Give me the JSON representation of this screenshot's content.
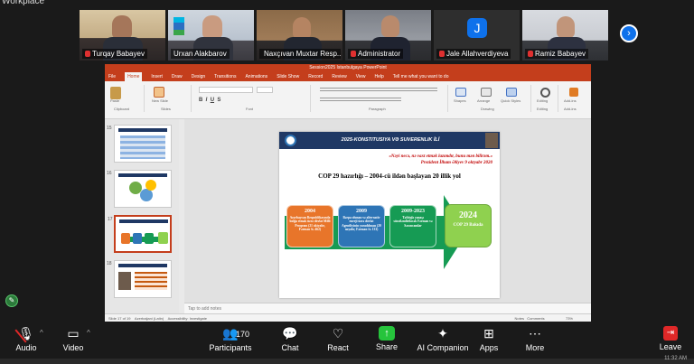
{
  "window": {
    "title": "Workplace"
  },
  "participants": [
    {
      "name": "Turqay Babayev",
      "muted": true
    },
    {
      "name": "Urxan Alakbarov",
      "muted": false,
      "active_speaker": true
    },
    {
      "name": "Naxçıvan Muxtar Resp...",
      "muted": true
    },
    {
      "name": "Administrator",
      "muted": true
    },
    {
      "name": "Jale Allahverdiyeva",
      "muted": true,
      "avatar_letter": "J"
    },
    {
      "name": "Ramiz Babayev",
      "muted": true
    }
  ],
  "gallery": {
    "next_icon": "chevron-right-icon"
  },
  "ppt": {
    "title_bar": "Session2025 Istanbulgaya PowerPoint",
    "tabs": [
      "File",
      "Home",
      "Insert",
      "Draw",
      "Design",
      "Transitions",
      "Animations",
      "Slide Show",
      "Record",
      "Review",
      "View",
      "Help",
      "Tell me what you want to do"
    ],
    "selected_tab": "Home",
    "ribbon_groups": [
      "Clipboard",
      "Slides",
      "Font",
      "Paragraph",
      "Drawing",
      "Editing",
      "Add-ins"
    ],
    "ribbon_buttons": {
      "paste": "Paste",
      "new_slide": "New Slide",
      "shapes": "Shapes",
      "arrange": "Arrange",
      "quick_styles": "Quick Styles",
      "editing": "Editing",
      "add_ins": "Add-ins"
    },
    "thumbnail_numbers": [
      "15",
      "16",
      "17",
      "18"
    ],
    "notes_placeholder": "Tap to add notes",
    "status": {
      "left": "Slide 17 of 19",
      "language": "Azerbaijani (Latin)",
      "accessibility": "Accessibility: Investigate",
      "notes": "Notes",
      "comments": "Comments",
      "zoom": "73%"
    }
  },
  "slide": {
    "header": "2025-KONSTITUSIYA VƏ SUVERENLIK İLİ",
    "quote_line1": "«Nəyi necə, nə vaxt etmək lazımdır, bunu mən bilirəm.»",
    "quote_line2": "Prezident İlham Əliyev 9 oktyabr 2020",
    "main_title": "COP 29 hazırlığı – 2004-cü ildən başlayan 20 illik yol",
    "boxes": [
      {
        "year": "2004",
        "text": "Azərbaycan Respublikasında bolğa etmək üzrə dövlət Milli Proqram (21 oktyabr, Fərman № 462)",
        "color": "#e8752a"
      },
      {
        "year": "2009",
        "text": "Bərpa olunan və alternativ enerji üzrə dövlət Agentliyinin yaradılması (20 noyabr, Fərman № 133)",
        "color": "#2e75b6"
      },
      {
        "year": "2009-2023",
        "text": "Tətbiqlə yanaşı sürətləndiriləcək Fərman və Sərəncamlar",
        "color": "#169b54"
      },
      {
        "year": "2024",
        "text": "COP 29 Bakıda",
        "color": "#8fd14f"
      }
    ]
  },
  "controls": [
    {
      "key": "audio",
      "label": "Audio",
      "icon": "mic-muted-icon"
    },
    {
      "key": "video",
      "label": "Video",
      "icon": "video-icon"
    },
    {
      "key": "participants",
      "label": "Participants",
      "icon": "participants-icon",
      "count": "170"
    },
    {
      "key": "chat",
      "label": "Chat",
      "icon": "chat-icon"
    },
    {
      "key": "react",
      "label": "React",
      "icon": "heart-icon"
    },
    {
      "key": "share",
      "label": "Share",
      "icon": "share-screen-icon"
    },
    {
      "key": "ai",
      "label": "AI Companion",
      "icon": "ai-sparkle-icon"
    },
    {
      "key": "apps",
      "label": "Apps",
      "icon": "apps-icon"
    },
    {
      "key": "more",
      "label": "More",
      "icon": "more-icon"
    },
    {
      "key": "leave",
      "label": "Leave",
      "icon": "leave-icon"
    }
  ],
  "taskbar": {
    "time": "11:32 AM"
  }
}
